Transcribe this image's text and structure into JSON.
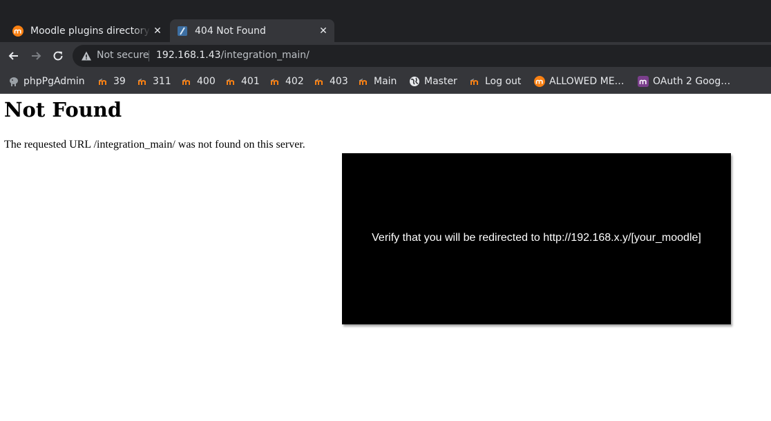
{
  "browser": {
    "tabs": [
      {
        "title": "Moodle plugins directory",
        "favicon": "moodle-icon",
        "active": false
      },
      {
        "title": "404 Not Found",
        "favicon": "page-icon",
        "active": true
      }
    ],
    "close_glyph": "✕",
    "new_tab_glyph": "+",
    "nav": {
      "back": "←",
      "forward": "→",
      "reload": "↻"
    },
    "address": {
      "security_label": "Not secure",
      "host": "192.168.1.43",
      "path": "/integration_main/"
    },
    "bookmarks": [
      {
        "label": "phpPgAdmin",
        "icon": "elephant-icon"
      },
      {
        "label": "39",
        "icon": "moodle-hat-icon"
      },
      {
        "label": "311",
        "icon": "moodle-hat-icon"
      },
      {
        "label": "400",
        "icon": "moodle-hat-icon"
      },
      {
        "label": "401",
        "icon": "moodle-hat-icon"
      },
      {
        "label": "402",
        "icon": "moodle-hat-icon"
      },
      {
        "label": "403",
        "icon": "moodle-hat-icon"
      },
      {
        "label": "Main",
        "icon": "moodle-hat-icon"
      },
      {
        "label": "Master",
        "icon": "globe-icon"
      },
      {
        "label": "Log out",
        "icon": "moodle-hat-icon"
      },
      {
        "label": "ALLOWED ME…",
        "icon": "moodle-orange-icon"
      },
      {
        "label": "OAuth 2 Goog…",
        "icon": "moodle-purple-icon"
      }
    ]
  },
  "page": {
    "heading": "Not Found",
    "message": "The requested URL /integration_main/ was not found on this server."
  },
  "overlay": {
    "text": "Verify that you will be redirected to http://192.168.x.y/[your_moodle]"
  },
  "colors": {
    "chrome_dark": "#202124",
    "chrome_toolbar": "#35363a",
    "moodle_orange": "#f98012",
    "overlay_bg": "#000000"
  }
}
